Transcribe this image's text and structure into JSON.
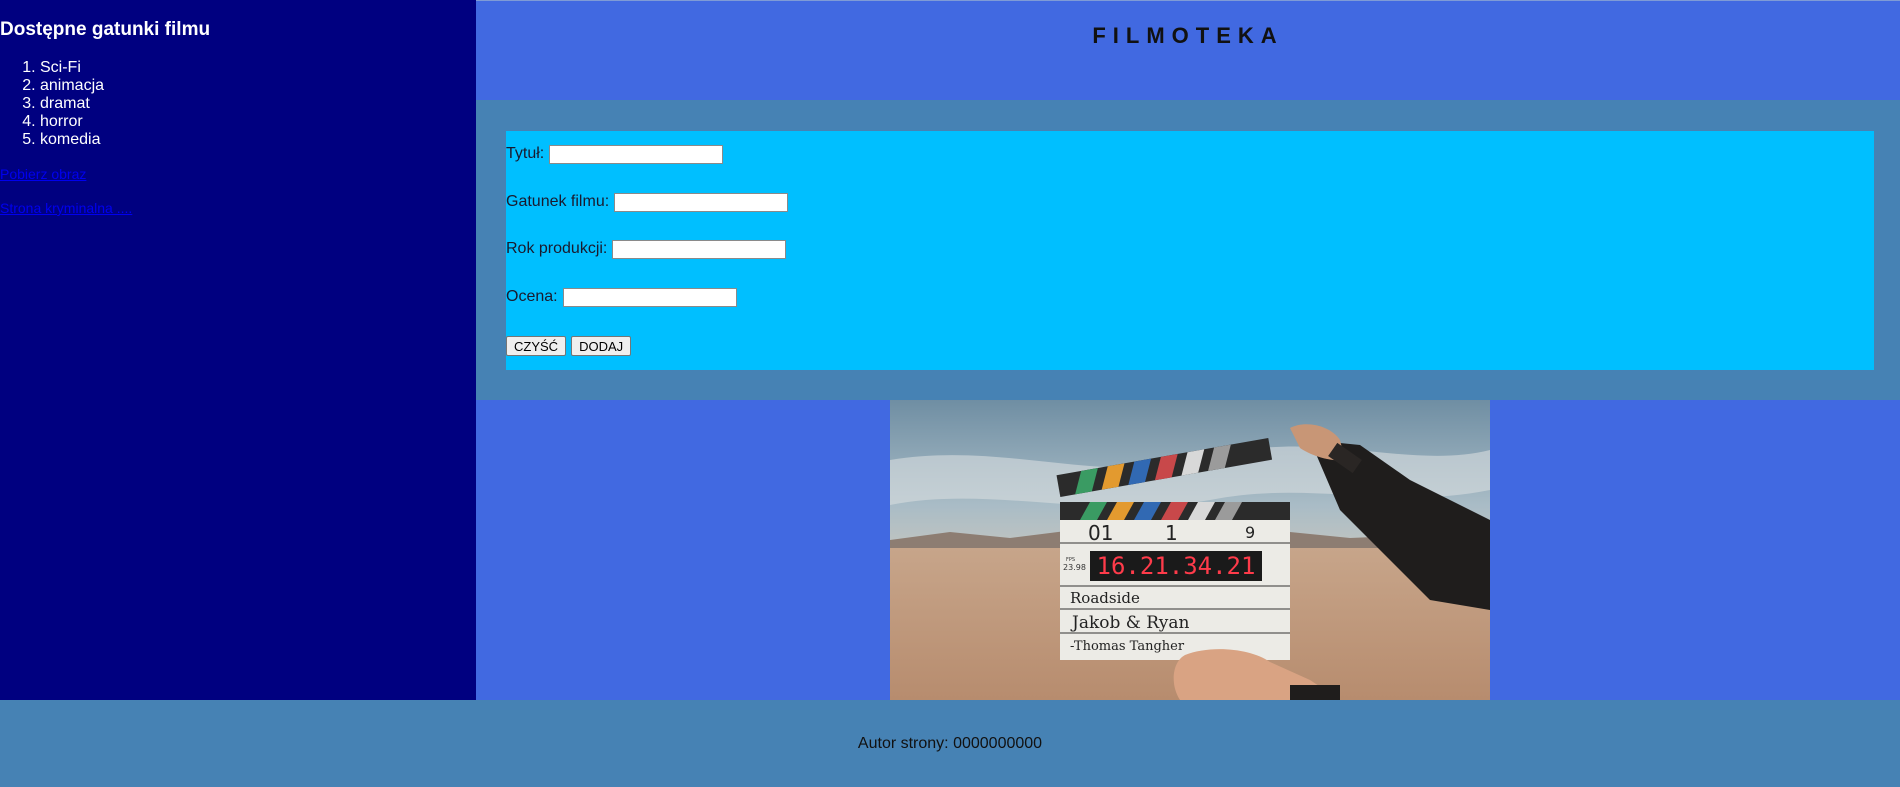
{
  "sidebar": {
    "heading": "Dostępne gatunki filmu",
    "genres": [
      "Sci-Fi",
      "animacja",
      "dramat",
      "horror",
      "komedia"
    ],
    "links": [
      {
        "label": "Pobierz obraz"
      },
      {
        "label": "Strona kryminalna ...."
      }
    ]
  },
  "header": {
    "title": "FILMOTEKA"
  },
  "form": {
    "fields": [
      {
        "label": "Tytuł:",
        "value": ""
      },
      {
        "label": "Gatunek filmu:",
        "value": ""
      },
      {
        "label": "Rok produkcji:",
        "value": ""
      },
      {
        "label": "Ocena:",
        "value": ""
      }
    ],
    "clear_label": "CZYŚĆ",
    "add_label": "DODAJ"
  },
  "image": {
    "clapper_roll": "01",
    "clapper_scene": "1",
    "clapper_take": "9",
    "clapper_timecode": "16.21.34.21",
    "clapper_fps": "FPS",
    "clapper_fps_value": "23.98",
    "clapper_production": "Roadside",
    "clapper_director": "Jakob & Ryan",
    "clapper_camera": "-Thomas Tangher"
  },
  "footer": {
    "author": "Autor strony: 0000000000"
  },
  "colors": {
    "sidebar_bg": "#000080",
    "header_bg": "#4169e1",
    "section_bg": "#4682b4",
    "form_bg": "#00bfff",
    "link": "#0000ee"
  }
}
